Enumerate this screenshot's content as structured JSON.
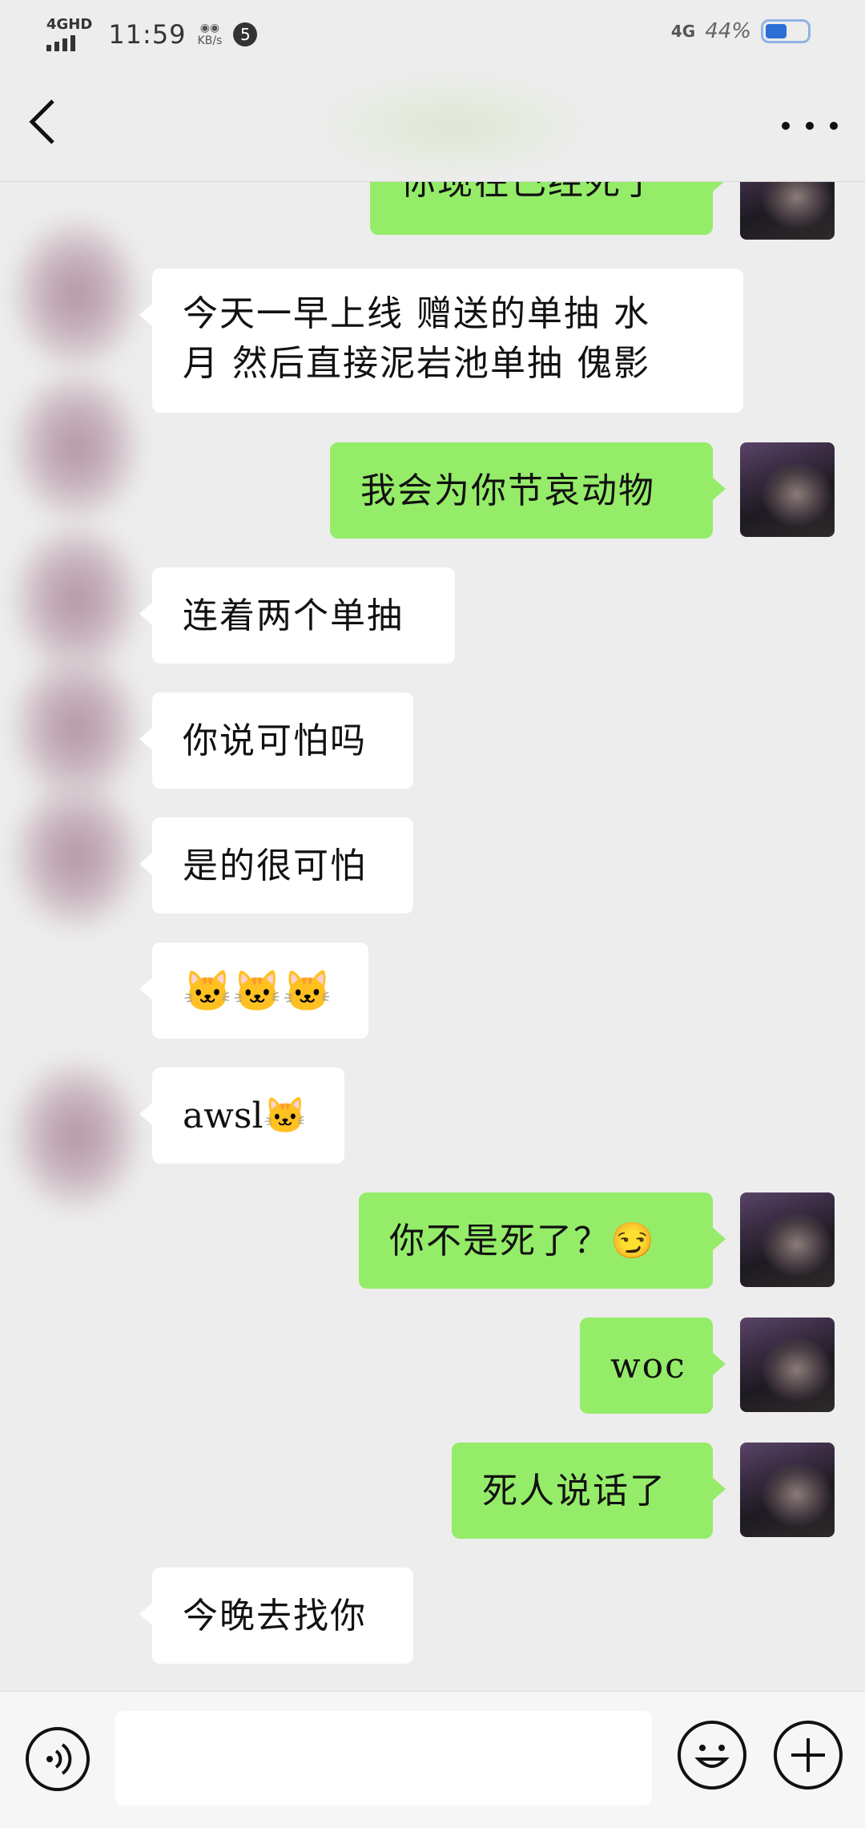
{
  "status_bar": {
    "network_type": "4GHD",
    "time": "11:59",
    "speed_label": "KB/s",
    "notification_count": "5",
    "mobile_network": "4G",
    "battery": "44%"
  },
  "nav": {
    "back_icon": "chevron-left-icon",
    "more_icon": "more-dots-icon"
  },
  "messages": [
    {
      "side": "outgoing",
      "text": "你现在已经死了"
    },
    {
      "side": "incoming",
      "text": "今天一早上线 赠送的单抽 水\n月 然后直接泥岩池单抽 傀影"
    },
    {
      "side": "outgoing",
      "text": "我会为你节哀动物"
    },
    {
      "side": "incoming",
      "text": "连着两个单抽"
    },
    {
      "side": "incoming",
      "text": "你说可怕吗"
    },
    {
      "side": "incoming",
      "text": "是的很可怕"
    },
    {
      "side": "incoming",
      "text": "🐱🐱🐱"
    },
    {
      "side": "incoming",
      "text": "awsl🐱"
    },
    {
      "side": "outgoing",
      "text": "你不是死了？😏"
    },
    {
      "side": "outgoing",
      "text": "woc"
    },
    {
      "side": "outgoing",
      "text": "死人说话了"
    },
    {
      "side": "incoming",
      "text": "今晚去找你"
    }
  ],
  "input_bar": {
    "voice_icon": "voice-icon",
    "input_value": "",
    "emoji_icon": "emoji-smile-icon",
    "plus_icon": "plus-icon"
  },
  "colors": {
    "background": "#ededed",
    "outgoing_bubble": "#95ec69",
    "incoming_bubble": "#ffffff"
  }
}
